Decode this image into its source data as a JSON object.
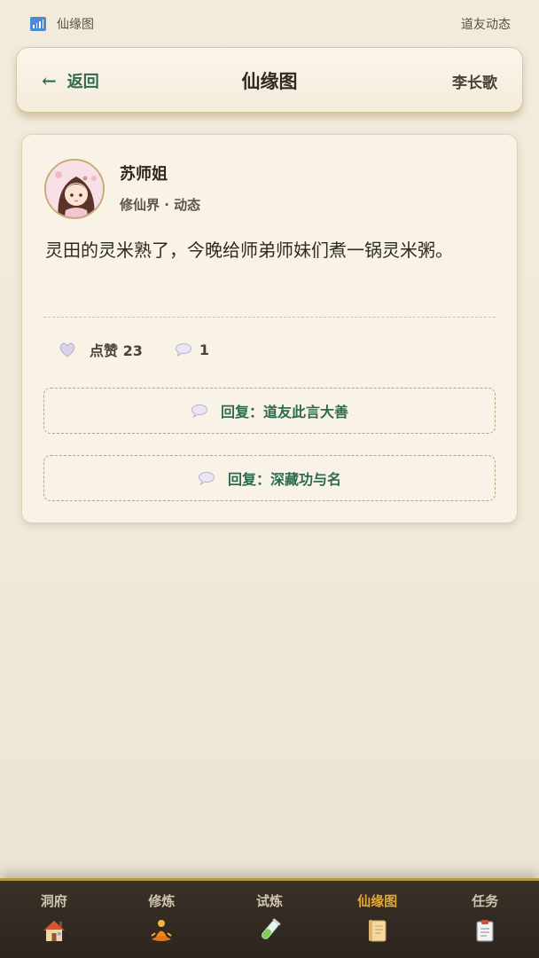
{
  "status_bar": {
    "app_name": "仙缘图",
    "right_text": "道友动态"
  },
  "header": {
    "back_label": "返回",
    "title": "仙缘图",
    "user_name": "李长歌"
  },
  "post": {
    "author": "苏师姐",
    "meta": "修仙界 · 动态",
    "content": "灵田的灵米熟了，今晚给师弟师妹们煮一锅灵米粥。",
    "like_label": "点赞 23",
    "comment_count": "1",
    "replies": [
      "回复：道友此言大善",
      "回复：深藏功与名"
    ]
  },
  "nav": {
    "items": [
      {
        "label": "洞府",
        "icon": "house-icon"
      },
      {
        "label": "修炼",
        "icon": "meditation-icon"
      },
      {
        "label": "试炼",
        "icon": "test-tube-icon"
      },
      {
        "label": "仙缘图",
        "icon": "scroll-icon",
        "active": true
      },
      {
        "label": "任务",
        "icon": "clipboard-icon"
      }
    ]
  },
  "colors": {
    "accent_green": "#2f6a50",
    "active_gold": "#e2a834",
    "nav_bg": "#2f2820"
  }
}
